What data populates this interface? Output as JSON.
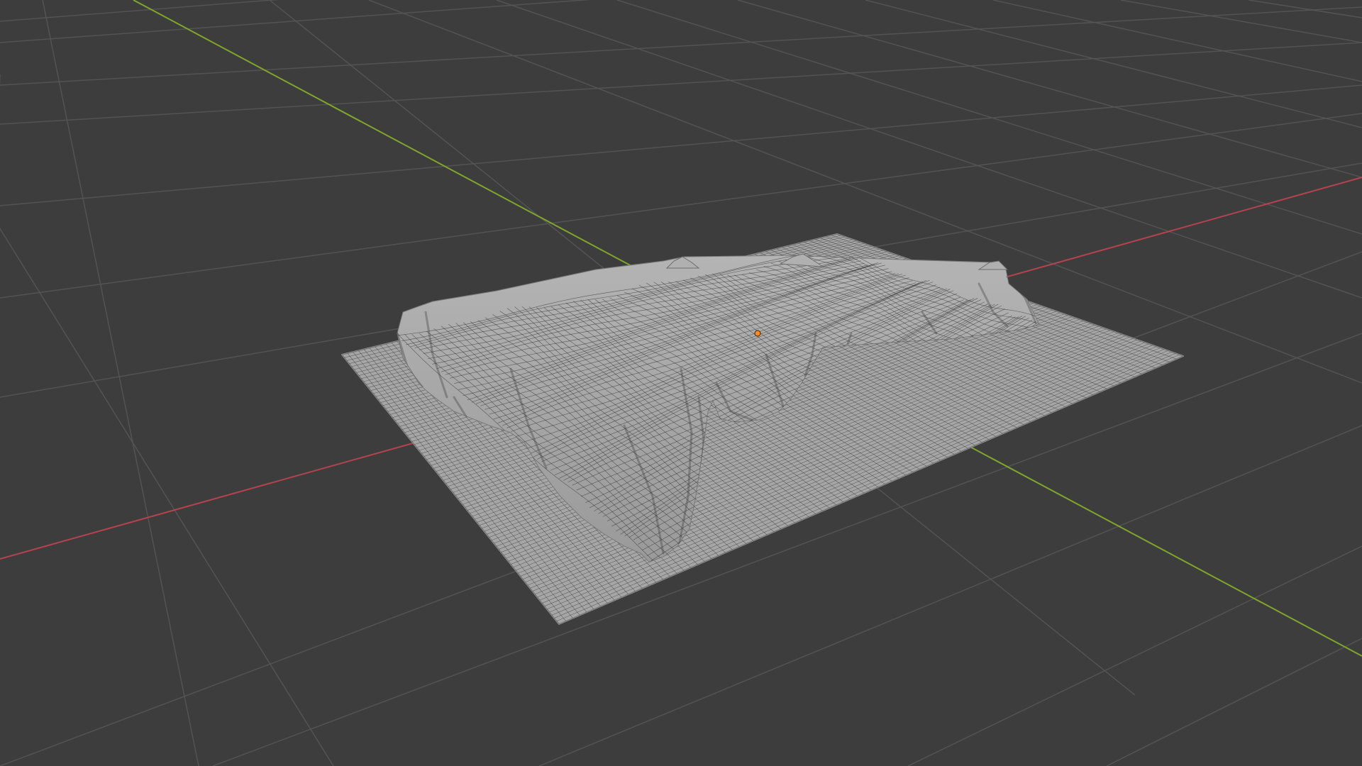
{
  "viewport": {
    "background": "#3d3d3d",
    "grid_color": "#555555",
    "x_axis_color": "#b5434f",
    "y_axis_color": "#7fa62c"
  },
  "scene": {
    "object": "terrain-mesh",
    "object_color": "#a8a8a8",
    "wire_color": "#2a2a2a",
    "origin_color": "#ff8a1e",
    "icons": [
      "object-origin-icon"
    ]
  }
}
